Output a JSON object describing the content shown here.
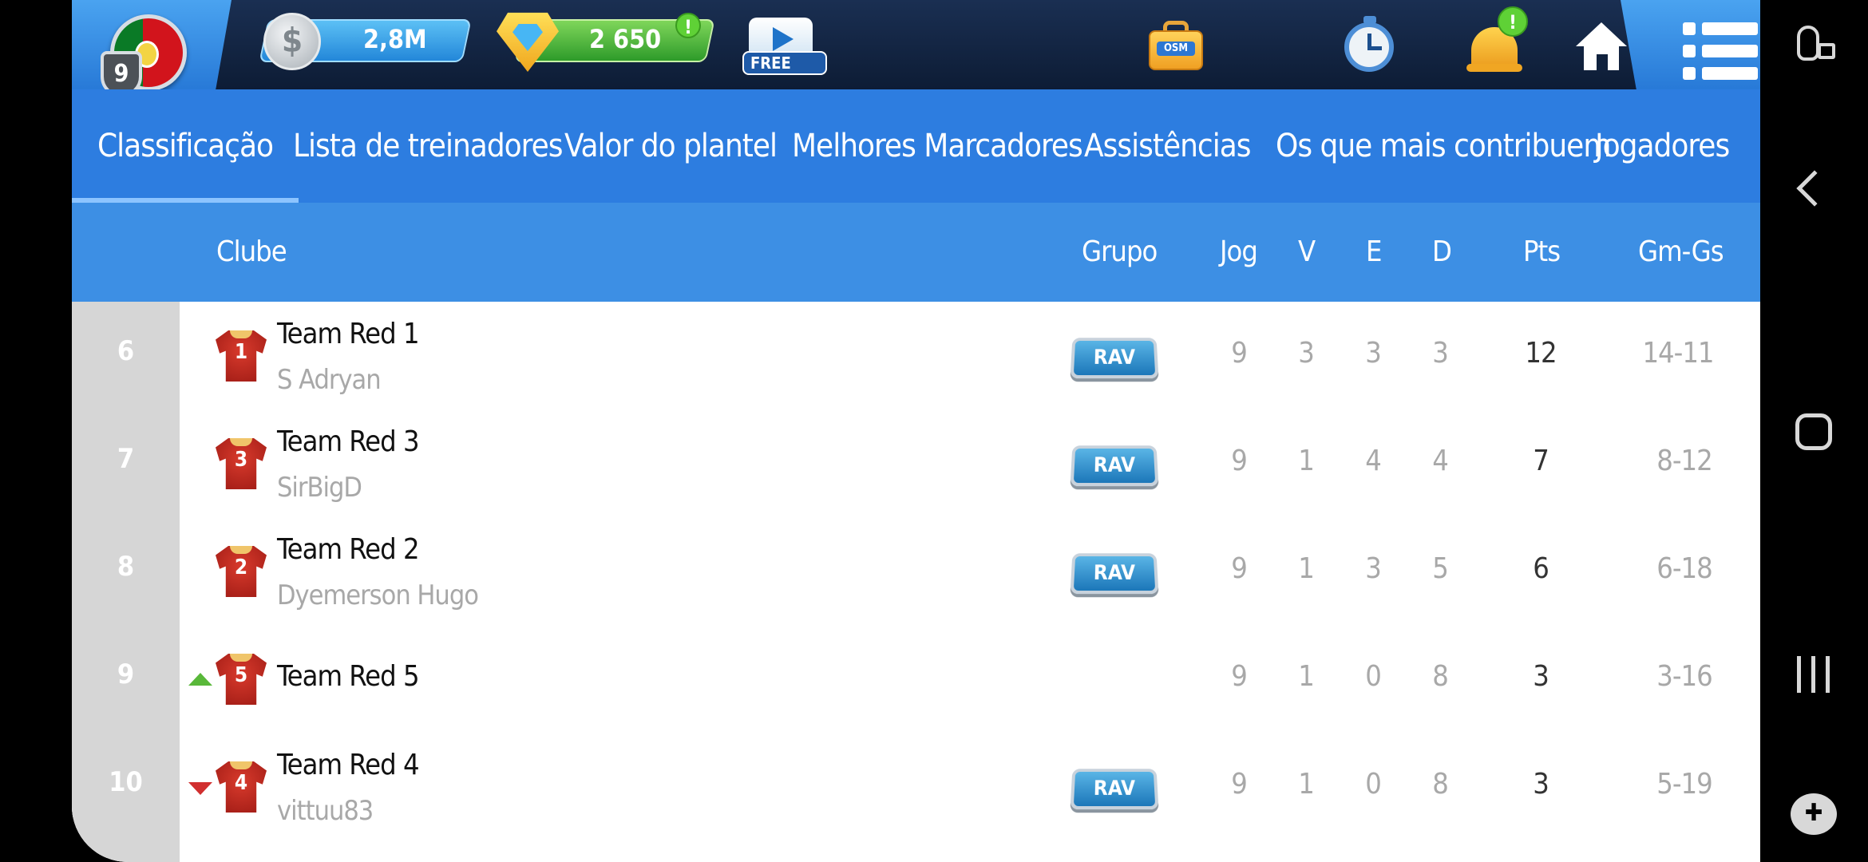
{
  "header": {
    "level": "9",
    "money": "2,8M",
    "coin_symbol": "$",
    "gems": "2 650",
    "free_video_label": "FREE",
    "osm_tag": "OSM",
    "alert_mark": "!",
    "icons": [
      "coin-icon",
      "gem-icon",
      "free-video-icon",
      "osm-bag-icon",
      "clock-icon",
      "bell-icon",
      "home-icon",
      "menu-icon"
    ]
  },
  "tabs": [
    {
      "label": "Classificação",
      "active": true
    },
    {
      "label": "Lista de treinadores",
      "active": false
    },
    {
      "label": "Valor do plantel",
      "active": false
    },
    {
      "label": "Melhores Marcadores",
      "active": false
    },
    {
      "label": "Assistências",
      "active": false
    },
    {
      "label": "Os que mais contribuem",
      "active": false
    },
    {
      "label": "Jogadores melh",
      "active": false
    }
  ],
  "columns": {
    "club": "Clube",
    "group": "Grupo",
    "played": "Jog",
    "won": "V",
    "drawn": "E",
    "lost": "D",
    "points": "Pts",
    "goals": "Gm-Gs"
  },
  "rows": [
    {
      "rank": "6",
      "jersey": "1",
      "team": "Team Red 1",
      "coach": "S Adryan",
      "group": "RAV",
      "played": "9",
      "won": "3",
      "drawn": "3",
      "lost": "3",
      "points": "12",
      "goals": "14-11",
      "trend": "none"
    },
    {
      "rank": "7",
      "jersey": "3",
      "team": "Team Red 3",
      "coach": "SirBigD",
      "group": "RAV",
      "played": "9",
      "won": "1",
      "drawn": "4",
      "lost": "4",
      "points": "7",
      "goals": "8-12",
      "trend": "none"
    },
    {
      "rank": "8",
      "jersey": "2",
      "team": "Team Red 2",
      "coach": "Dyemerson Hugo",
      "group": "RAV",
      "played": "9",
      "won": "1",
      "drawn": "3",
      "lost": "5",
      "points": "6",
      "goals": "6-18",
      "trend": "none"
    },
    {
      "rank": "9",
      "jersey": "5",
      "team": "Team Red 5",
      "coach": "",
      "group": "",
      "played": "9",
      "won": "1",
      "drawn": "0",
      "lost": "8",
      "points": "3",
      "goals": "3-16",
      "trend": "up"
    },
    {
      "rank": "10",
      "jersey": "4",
      "team": "Team Red 4",
      "coach": "vittuu83",
      "group": "RAV",
      "played": "9",
      "won": "1",
      "drawn": "0",
      "lost": "8",
      "points": "3",
      "goals": "5-19",
      "trend": "down"
    }
  ],
  "colors": {
    "topbar": "#10223e",
    "tab_bar": "#2d7de0",
    "header_row": "#3d8fe4",
    "rank_column": "#d6d6d6",
    "trend_up": "#59b83a",
    "trend_down": "#d12f2f"
  }
}
